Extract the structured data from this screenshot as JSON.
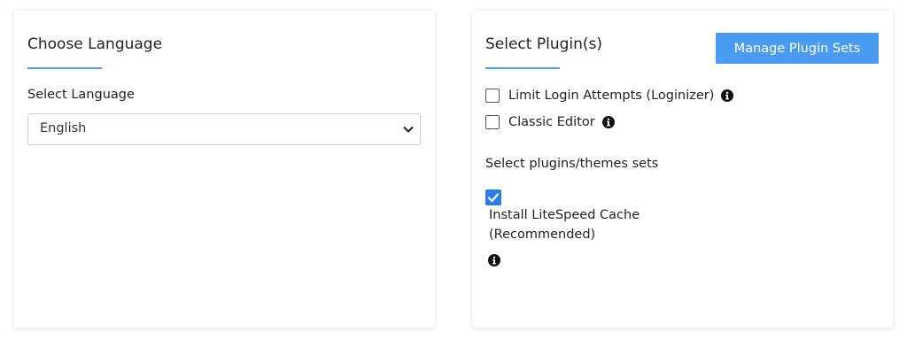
{
  "language_panel": {
    "title": "Choose Language",
    "field_label": "Select Language",
    "selected_language": "English",
    "accent_color": "#4a9be9"
  },
  "plugin_panel": {
    "title": "Select Plugin(s)",
    "manage_button_label": "Manage Plugin Sets",
    "button_color": "#4a9bf2",
    "plugins": [
      {
        "label": "Limit Login Attempts (Loginizer)",
        "checked": false,
        "icon": "info-icon"
      },
      {
        "label": "Classic Editor",
        "checked": false,
        "icon": "info-icon"
      }
    ],
    "sets_label": "Select plugins/themes sets",
    "sets": [
      {
        "label_line1": "Install LiteSpeed Cache",
        "label_line2": "(Recommended)",
        "checked": true,
        "icon": "info-icon"
      }
    ]
  }
}
